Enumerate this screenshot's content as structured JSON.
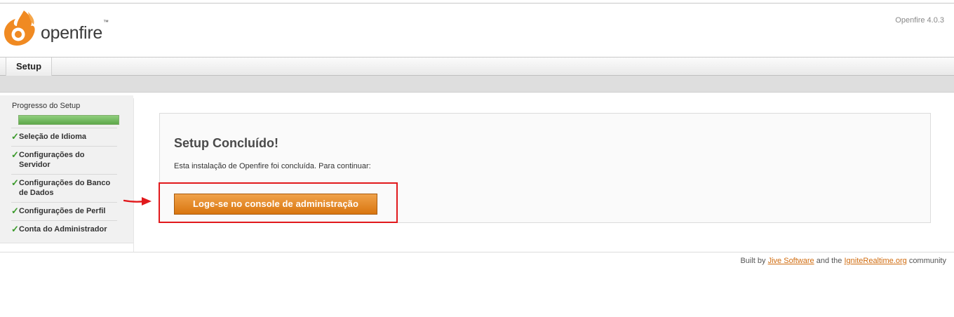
{
  "header": {
    "logo_text": "openfire",
    "trademark": "™",
    "version": "Openfire 4.0.3",
    "logo_icon": "openfire-flame-icon"
  },
  "tabs": [
    {
      "label": "Setup"
    }
  ],
  "sidebar": {
    "title": "Progresso do Setup",
    "progress": 1.0,
    "items": [
      {
        "label": "Seleção de Idioma",
        "icon": "checkmark-icon"
      },
      {
        "label": "Configurações do Servidor",
        "icon": "checkmark-icon"
      },
      {
        "label": "Configurações do Banco de Dados",
        "icon": "checkmark-icon"
      },
      {
        "label": "Configurações de Perfil",
        "icon": "checkmark-icon"
      },
      {
        "label": "Conta do Administrador",
        "icon": "checkmark-icon"
      }
    ]
  },
  "main": {
    "title": "Setup Concluído!",
    "description": "Esta instalação de Openfire foi concluída. Para continuar:",
    "button_label": "Loge-se no console de administração"
  },
  "footer": {
    "prefix": "Built by",
    "link1": "Jive Software",
    "middle": "and the",
    "link2": "IgniteRealtime.org",
    "suffix": "community"
  },
  "colors": {
    "accent": "#d9760f",
    "highlight": "#e1191c",
    "progress": "#5ea84a",
    "link": "#d06b0e"
  }
}
